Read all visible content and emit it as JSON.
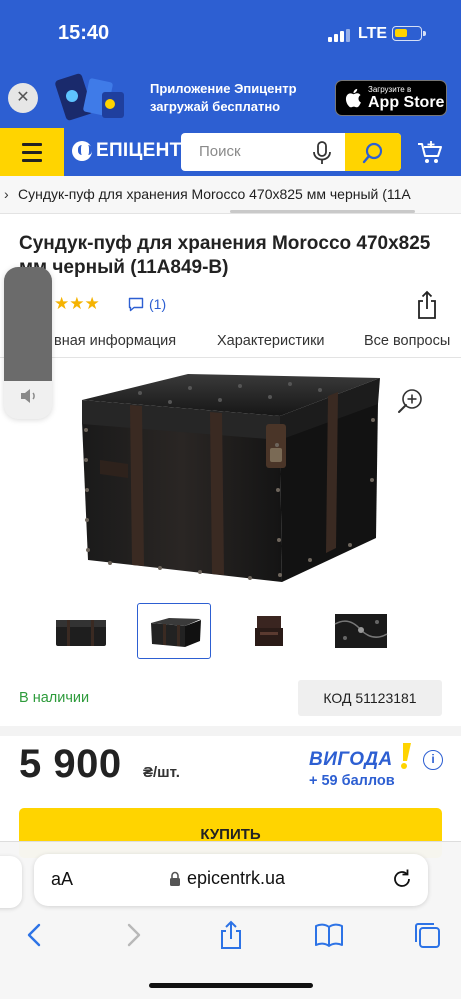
{
  "status": {
    "time": "15:40",
    "network": "LTE"
  },
  "banner": {
    "line1": "Приложение Эпицентр",
    "line2": "загружай бесплатно",
    "store_small": "Загрузите в",
    "store_big": "App Store"
  },
  "header": {
    "logo": "ЕПІЦЕНТР",
    "search_placeholder": "Поиск"
  },
  "breadcrumb": {
    "text": "Сундук-пуф для хранения Morocco 470x825 мм черный (11A"
  },
  "product": {
    "title": "Сундук-пуф для хранения Morocco 470x825 мм черный (11A849-B)",
    "rating_stars": "★★★",
    "reviews": "(1)",
    "availability": "В наличии",
    "code": "КОД 51123181",
    "price": "5 900",
    "unit": "₴/шт.",
    "vygoda": "ВИГОДА",
    "bonus": "+ 59 баллов",
    "buy": "КУПИТЬ"
  },
  "tabs": [
    {
      "label": "вная информация"
    },
    {
      "label": "Характеристики"
    },
    {
      "label": "Все вопросы"
    }
  ],
  "safari": {
    "aa": "аА",
    "url": "epicentrk.ua"
  },
  "colors": {
    "brand_blue": "#2d5fd2",
    "brand_yellow": "#ffd400",
    "in_stock_green": "#2d9b3b"
  }
}
